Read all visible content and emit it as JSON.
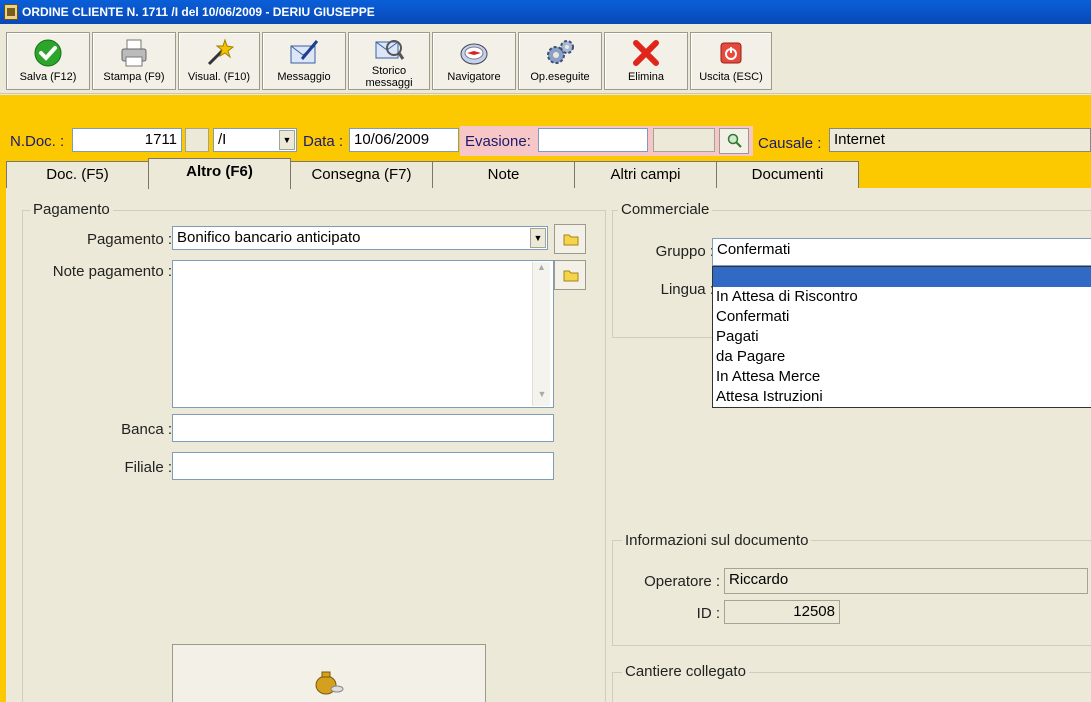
{
  "window": {
    "title": "ORDINE CLIENTE N. 1711 /I del 10/06/2009 - DERIU GIUSEPPE"
  },
  "toolbar": {
    "buttons": [
      {
        "label": "Salva (F12)",
        "icon": "check-icon"
      },
      {
        "label": "Stampa (F9)",
        "icon": "printer-icon"
      },
      {
        "label": "Visual. (F10)",
        "icon": "magic-wand-icon"
      },
      {
        "label": "Messaggio",
        "icon": "envelope-pen-icon"
      },
      {
        "label": "Storico\nmessaggi",
        "label1": "Storico",
        "label2": "messaggi",
        "icon": "envelope-search-icon"
      },
      {
        "label": "Navigatore",
        "icon": "compass-icon"
      },
      {
        "label": "Op.eseguite",
        "icon": "gears-icon"
      },
      {
        "label": "Elimina",
        "icon": "red-x-icon"
      },
      {
        "label": "Uscita (ESC)",
        "icon": "power-icon"
      }
    ]
  },
  "header": {
    "ndoc_label": "N.Doc. :",
    "ndoc_value": "1711",
    "serie_value": "/I",
    "data_label": "Data :",
    "data_value": "10/06/2009",
    "evasione_label": "Evasione:",
    "evasione_value": "",
    "causale_label": "Causale :",
    "causale_value": "Internet"
  },
  "tabs": [
    {
      "label": "Doc. (F5)",
      "active": false
    },
    {
      "label": "Altro (F6)",
      "active": true
    },
    {
      "label": "Consegna (F7)",
      "active": false
    },
    {
      "label": "Note",
      "active": false
    },
    {
      "label": "Altri campi",
      "active": false
    },
    {
      "label": "Documenti",
      "active": false
    }
  ],
  "pagamento": {
    "legend": "Pagamento",
    "pagamento_label": "Pagamento :",
    "pagamento_value": "Bonifico bancario anticipato",
    "note_label": "Note pagamento :",
    "note_value": "",
    "banca_label": "Banca :",
    "banca_value": "",
    "filiale_label": "Filiale :",
    "filiale_value": ""
  },
  "commerciale": {
    "legend": "Commerciale",
    "gruppo_label": "Gruppo :",
    "gruppo_value": "Confermati",
    "lingua_label": "Lingua :",
    "gruppo_options": [
      "",
      "In Attesa di Riscontro",
      "Confermati",
      "Pagati",
      "da Pagare",
      "In Attesa Merce",
      "Attesa Istruzioni"
    ]
  },
  "info": {
    "legend": "Informazioni sul documento",
    "operatore_label": "Operatore :",
    "operatore_value": "Riccardo",
    "id_label": "ID :",
    "id_value": "12508"
  },
  "cantiere": {
    "legend": "Cantiere collegato"
  },
  "colors": {
    "accent": "#fcc800",
    "titlebar": "#0a5fd8",
    "selection": "#316ac5",
    "evasione_bg": "#f7c6c6"
  }
}
